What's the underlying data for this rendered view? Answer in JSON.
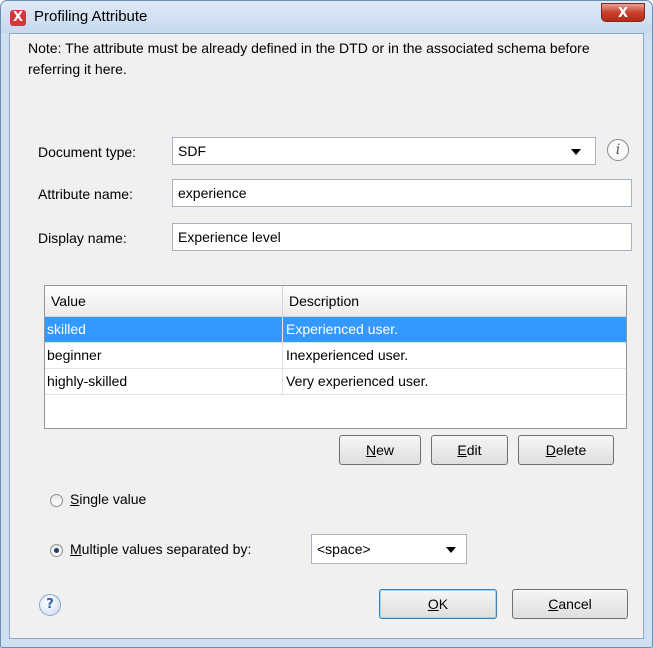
{
  "window": {
    "title": "Profiling Attribute",
    "close_label": "X"
  },
  "note": "Note: The attribute must be already defined in the DTD or in the associated schema before referring it here.",
  "fields": {
    "document_type_label": "Document type:",
    "document_type_value": "SDF",
    "attribute_name_label": "Attribute name:",
    "attribute_name_value": "experience",
    "display_name_label": "Display name:",
    "display_name_value": "Experience level"
  },
  "table": {
    "columns": [
      "Value",
      "Description"
    ],
    "rows": [
      {
        "value": "skilled",
        "description": "Experienced user.",
        "selected": true
      },
      {
        "value": "beginner",
        "description": "Inexperienced user.",
        "selected": false
      },
      {
        "value": "highly-skilled",
        "description": "Very experienced user.",
        "selected": false
      }
    ]
  },
  "table_buttons": {
    "new": {
      "mnemonic": "N",
      "rest": "ew"
    },
    "edit": {
      "mnemonic": "E",
      "rest": "dit"
    },
    "delete": {
      "mnemonic": "D",
      "rest": "elete"
    }
  },
  "options": {
    "single": {
      "mnemonic": "S",
      "rest": "ingle value",
      "selected": false
    },
    "multiple": {
      "mnemonic": "M",
      "rest": "ultiple values separated by:",
      "selected": true
    },
    "separator_value": "<space>"
  },
  "footer": {
    "help_icon": "?",
    "ok": {
      "mnemonic": "O",
      "rest": "K"
    },
    "cancel": {
      "mnemonic": "C",
      "rest": "ancel"
    }
  },
  "icons": {
    "app": "oxygen-x-icon",
    "info": "info-icon",
    "help": "help-icon",
    "dropdown": "chevron-down-icon"
  }
}
